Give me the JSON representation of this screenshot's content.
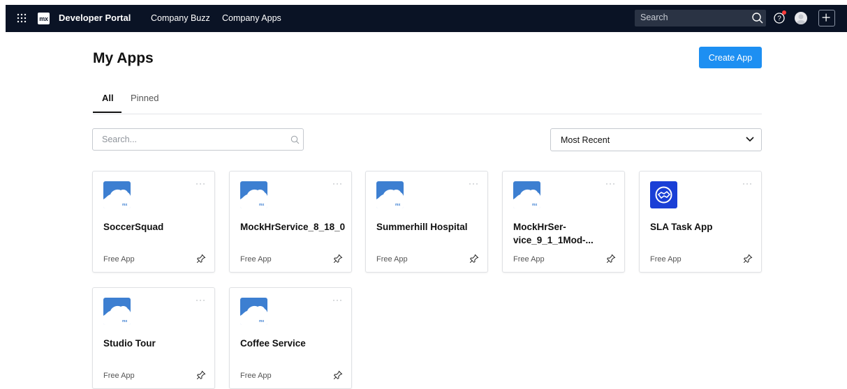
{
  "nav": {
    "brand": "Developer Portal",
    "logo_text": "mx",
    "links": [
      "Company Buzz",
      "Company Apps"
    ],
    "search_placeholder": "Search"
  },
  "page": {
    "title": "My Apps",
    "create_button": "Create App",
    "tabs": [
      "All",
      "Pinned"
    ],
    "active_tab": "All",
    "search_placeholder": "Search...",
    "sort_selected": "Most Recent"
  },
  "apps": [
    {
      "name": "SoccerSquad",
      "type": "Free App",
      "icon": "mendix-cloud-icon"
    },
    {
      "name": "MockHrService_8_18_0",
      "type": "Free App",
      "icon": "mendix-cloud-icon"
    },
    {
      "name": "Summerhill Hospital",
      "type": "Free App",
      "icon": "mendix-cloud-icon"
    },
    {
      "name": "MockHrSer-vice_9_1_1Mod-...",
      "type": "Free App",
      "icon": "mendix-cloud-icon"
    },
    {
      "name": "SLA Task App",
      "type": "Free App",
      "icon": "handshake-icon"
    },
    {
      "name": "Studio Tour",
      "type": "Free App",
      "icon": "mendix-cloud-icon"
    },
    {
      "name": "Coffee Service",
      "type": "Free App",
      "icon": "mendix-cloud-icon"
    }
  ],
  "colors": {
    "topbar": "#0a1325",
    "accent": "#1d8ff2",
    "app_icon_blue": "#3d7fd1",
    "sla_icon_blue": "#1a3fd6"
  }
}
